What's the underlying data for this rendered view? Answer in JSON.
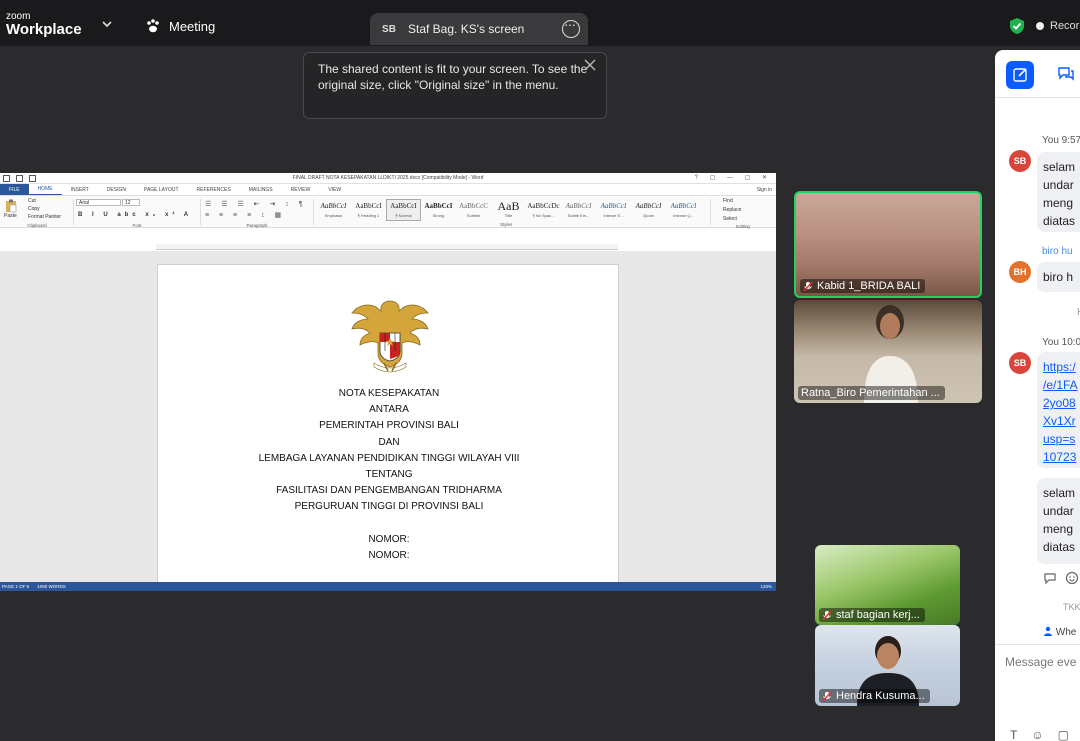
{
  "topbar": {
    "brand_small": "zoom",
    "brand_large": "Workplace",
    "meeting_label": "Meeting",
    "share_initials": "SB",
    "share_label": "Staf Bag. KS's screen",
    "recording_label": "Recor"
  },
  "tooltip": {
    "line1": "The shared content is fit to your screen. To see the",
    "line2": "original size, click \"Original size\" in the menu."
  },
  "word": {
    "title": "FINAL DRAFT NOTA KESEPAKATAN LLDIKTI 2025.docx [Compatibility Mode] - Word",
    "tabs": [
      "FILE",
      "HOME",
      "INSERT",
      "DESIGN",
      "PAGE LAYOUT",
      "REFERENCES",
      "MAILINGS",
      "REVIEW",
      "VIEW"
    ],
    "sign_in": "Sign in",
    "clipboard": {
      "paste": "Paste",
      "cut": "Cut",
      "copy": "Copy",
      "format_painter": "Format Painter",
      "group": "Clipboard"
    },
    "font": {
      "name": "Arial",
      "size": "12",
      "group": "Font"
    },
    "paragraph_group": "Paragraph",
    "styles_group": "Styles",
    "styles": [
      {
        "preview": "AaBbCcI",
        "name": "Emphasis"
      },
      {
        "preview": "AaBbCcI",
        "name": "¶ Heading 1"
      },
      {
        "preview": "AaBbCcI",
        "name": "¶ Normal"
      },
      {
        "preview": "AaBbCcI",
        "name": "Strong"
      },
      {
        "preview": "AaBbCcC",
        "name": "Subtitle"
      },
      {
        "preview": "AaB",
        "name": "Title"
      },
      {
        "preview": "AaBbCcDc",
        "name": "¶ No Spac..."
      },
      {
        "preview": "AaBbCcI",
        "name": "Subtle Em..."
      },
      {
        "preview": "AaBbCcI",
        "name": "Intense E..."
      },
      {
        "preview": "AaBbCcI",
        "name": "Quote"
      },
      {
        "preview": "AaBbCcI",
        "name": "Intense Q..."
      }
    ],
    "editing": {
      "find": "Find",
      "replace": "Replace",
      "select": "Select",
      "group": "Editing"
    },
    "doc_lines": [
      "NOTA KESEPAKATAN",
      "ANTARA",
      "PEMERINTAH PROVINSI BALI",
      "DAN",
      "LEMBAGA LAYANAN PENDIDIKAN TINGGI WILAYAH VIII",
      "TENTANG",
      "FASILITASI DAN PENGEMBANGAN TRIDHARMA",
      "PERGURUAN TINGGI DI PROVINSI BALI",
      "",
      "NOMOR:",
      "NOMOR:"
    ],
    "status": {
      "page": "PAGE 1 OF 6",
      "words": "1080 WORDS",
      "zoom": "120%"
    }
  },
  "participants": [
    {
      "name": "Kabid 1_BRIDA BALI"
    },
    {
      "name": "Ratna_Biro Pemerintahan ..."
    },
    {
      "name": "staf bagian kerj..."
    },
    {
      "name": "Hendra Kusuma..."
    }
  ],
  "chat": {
    "messages": [
      {
        "meta": "You 9:57",
        "initials": "SB",
        "lines": [
          "selam",
          "undar",
          "meng",
          "diatas"
        ]
      },
      {
        "meta": "biro hu",
        "initials": "BH",
        "lines": [
          "biro h"
        ]
      },
      {
        "meta": "You 10:0",
        "initials": "SB",
        "lines": [
          "https:/",
          "/e/1FA",
          "2yo08",
          "Xv1Xr",
          "usp=s",
          "10723"
        ]
      },
      {
        "meta": "",
        "initials": "",
        "lines": [
          "selam",
          "undar",
          "meng",
          "diatas"
        ]
      }
    ],
    "mid_marker": "H",
    "tkk_label": "TKK",
    "who_label": "Whe",
    "input_placeholder": "Message eve"
  },
  "colors": {
    "accent": "#0b5cff",
    "word_blue": "#2b579a",
    "active_speaker": "#23d160"
  }
}
